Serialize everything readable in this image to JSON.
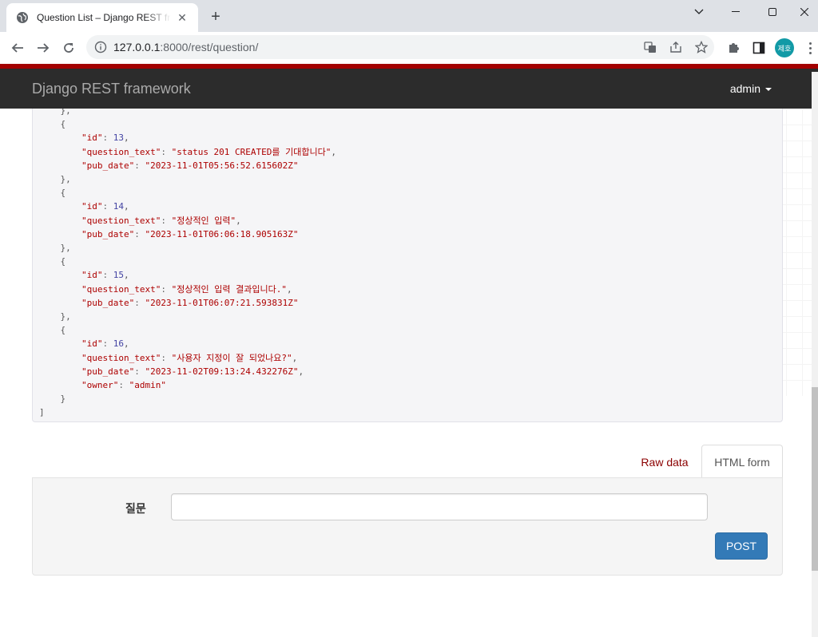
{
  "browser": {
    "tab_title": "Question List – Django REST framework",
    "url_host": "127.0.0.1",
    "url_port_path": ":8000/rest/question/",
    "profile_initials": "제호",
    "icons": [
      "globe-icon",
      "close-icon",
      "new-tab-icon",
      "minimize-icon",
      "maximize-icon",
      "window-close-icon",
      "back-icon",
      "forward-icon",
      "reload-icon",
      "info-icon",
      "translate-icon",
      "share-icon",
      "bookmark-star-icon",
      "extensions-icon",
      "side-panel-icon",
      "more-menu-icon"
    ]
  },
  "navbar": {
    "brand": "Django REST framework",
    "user": "admin"
  },
  "response": {
    "lines": [
      "    },",
      "    {",
      "        \"id\": 13,",
      "        \"question_text\": \"status 201 CREATED를 기대합니다\",",
      "        \"pub_date\": \"2023-11-01T05:56:52.615602Z\"",
      "    },",
      "    {",
      "        \"id\": 14,",
      "        \"question_text\": \"정상적인 입력\",",
      "        \"pub_date\": \"2023-11-01T06:06:18.905163Z\"",
      "    },",
      "    {",
      "        \"id\": 15,",
      "        \"question_text\": \"정상적인 입력 결과입니다.\",",
      "        \"pub_date\": \"2023-11-01T06:07:21.593831Z\"",
      "    },",
      "    {",
      "        \"id\": 16,",
      "        \"question_text\": \"사용자 지정이 잘 되었나요?\",",
      "        \"pub_date\": \"2023-11-02T09:13:24.432276Z\",",
      "        \"owner\": \"admin\"",
      "    }",
      "]"
    ]
  },
  "form": {
    "tab_raw": "Raw data",
    "tab_html": "HTML form",
    "field_label": "질문",
    "field_value": "",
    "submit_label": "POST"
  },
  "colors": {
    "accent_red": "#a30000",
    "navbar_bg": "#2c2c2c",
    "post_button": "#337ab7",
    "json_key": "#ad0000",
    "json_number": "#4343a3"
  }
}
